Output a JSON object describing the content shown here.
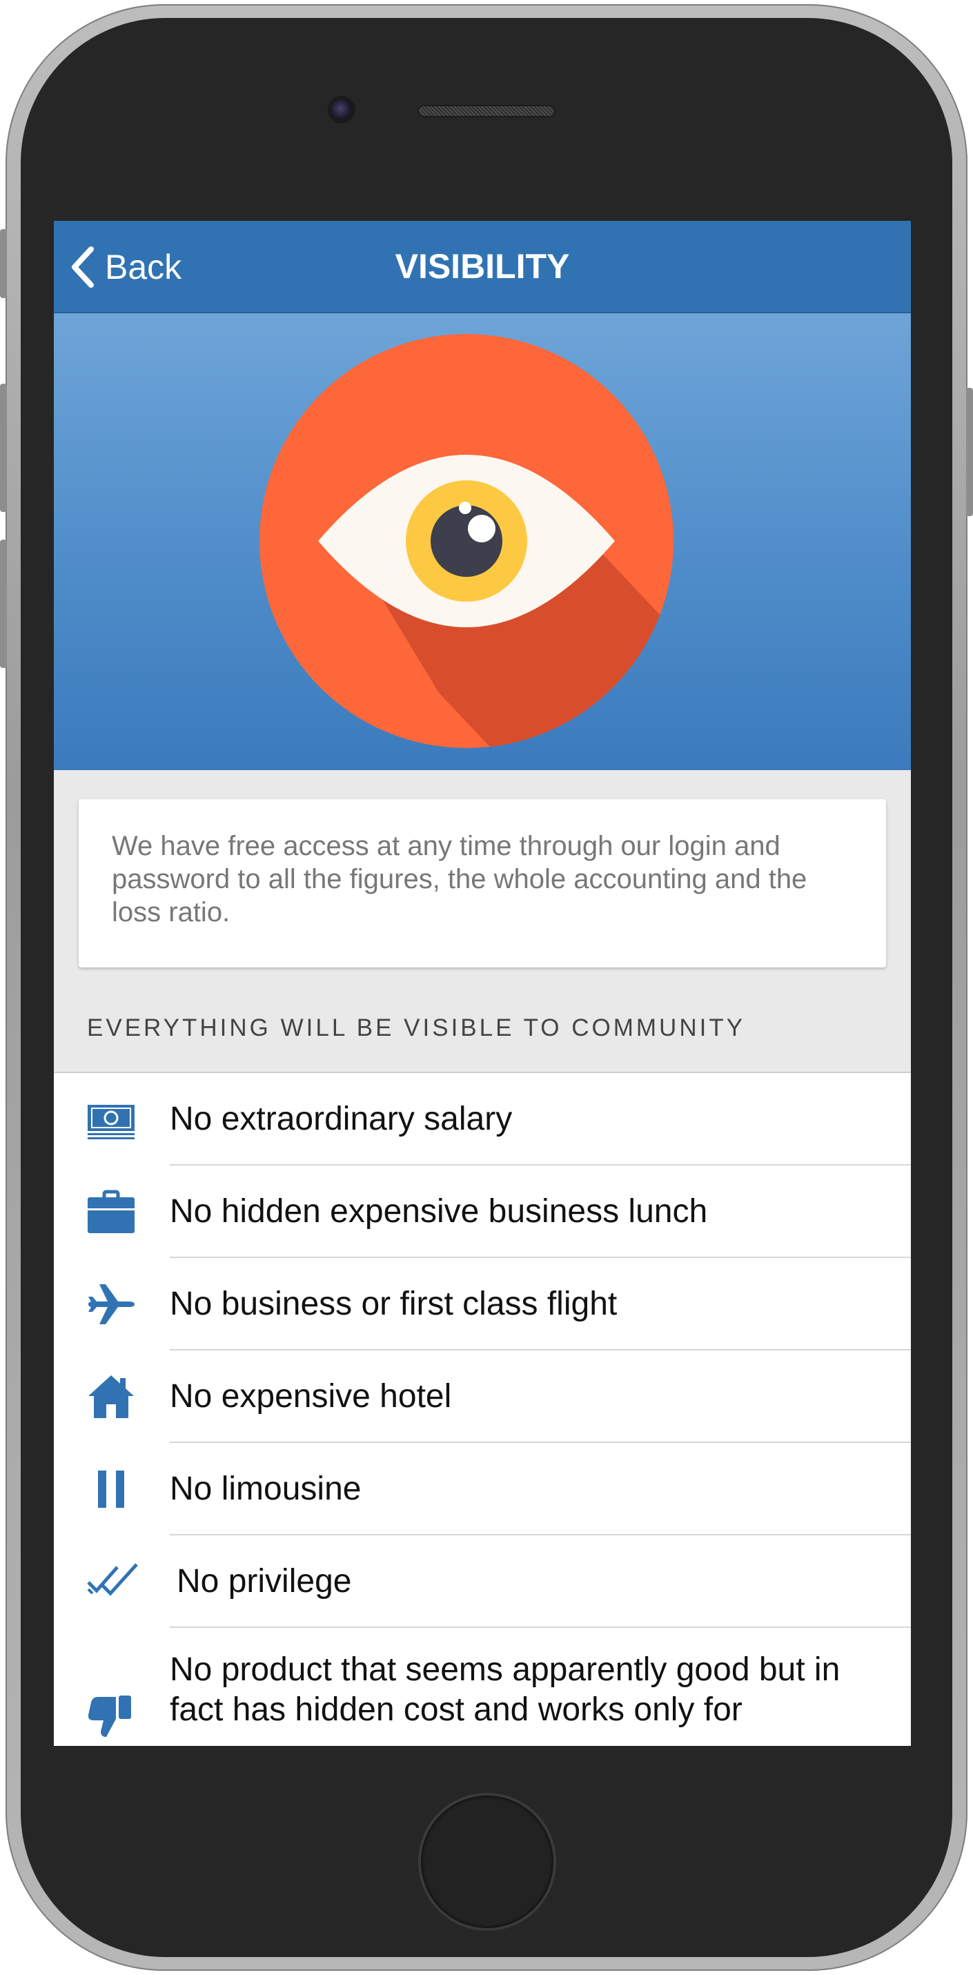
{
  "nav": {
    "back_label": "Back",
    "title": "VISIBILITY"
  },
  "hero": {
    "icon": "eye-icon"
  },
  "intro": {
    "text": "We have free access at any time through our login and password to all the figures, the whole accounting and the loss ratio."
  },
  "section": {
    "header": "EVERYTHING WILL BE VISIBLE TO COMMUNITY"
  },
  "items": [
    {
      "label": "No extraordinary salary",
      "icon": "money-icon"
    },
    {
      "label": "No hidden expensive business lunch",
      "icon": "briefcase-icon"
    },
    {
      "label": "No business or first class flight",
      "icon": "airplane-icon"
    },
    {
      "label": "No expensive hotel",
      "icon": "house-icon"
    },
    {
      "label": "No limousine",
      "icon": "pause-icon"
    },
    {
      "label": "No privilege",
      "icon": "double-check-icon"
    },
    {
      "label": "No product that seems apparently good but in fact has hidden cost and works only for",
      "icon": "thumbs-down-icon"
    }
  ],
  "colors": {
    "nav_bg": "#3173b2",
    "hero_top": "#6ea5d8",
    "hero_bottom": "#3b7bbd",
    "circle": "#fd673a",
    "circle_shadow": "#d84e2c",
    "iris": "#fdc943",
    "icon_blue": "#3173b2"
  }
}
